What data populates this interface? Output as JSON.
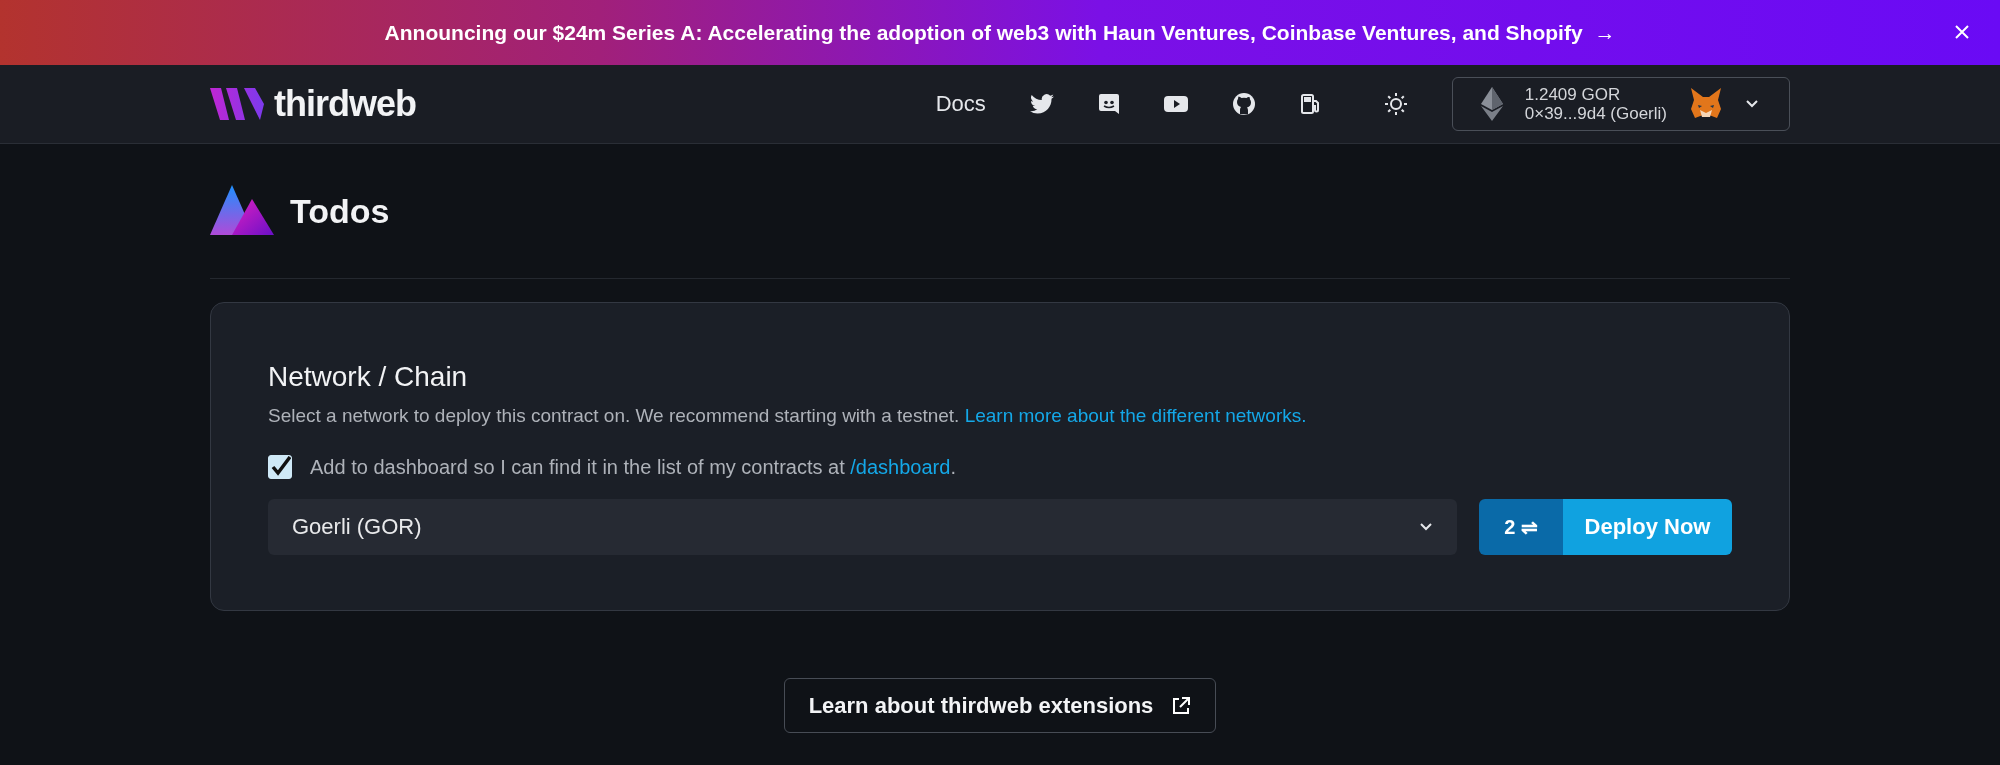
{
  "banner": {
    "text": "Announcing our $24m Series A: Accelerating the adoption of web3 with Haun Ventures, Coinbase Ventures, and Shopify",
    "arrow": "→"
  },
  "nav": {
    "logo_text": "thirdweb",
    "docs": "Docs",
    "wallet": {
      "balance": "1.2409 GOR",
      "address": "0×39...9d4 (Goerli)"
    }
  },
  "page": {
    "title": "Todos"
  },
  "network": {
    "heading": "Network / Chain",
    "description": "Select a network to deploy this contract on. We recommend starting with a testnet. ",
    "description_link": "Learn more about the different networks.",
    "checkbox": {
      "checked": true,
      "label": "Add to dashboard so I can find it in the list of my contracts at ",
      "link": "/dashboard",
      "suffix": "."
    },
    "select": {
      "value": "Goerli (GOR)"
    },
    "deploy": {
      "count": "2",
      "swap": "⇌",
      "label": "Deploy Now"
    }
  },
  "extensions_button": "Learn about thirdweb extensions"
}
